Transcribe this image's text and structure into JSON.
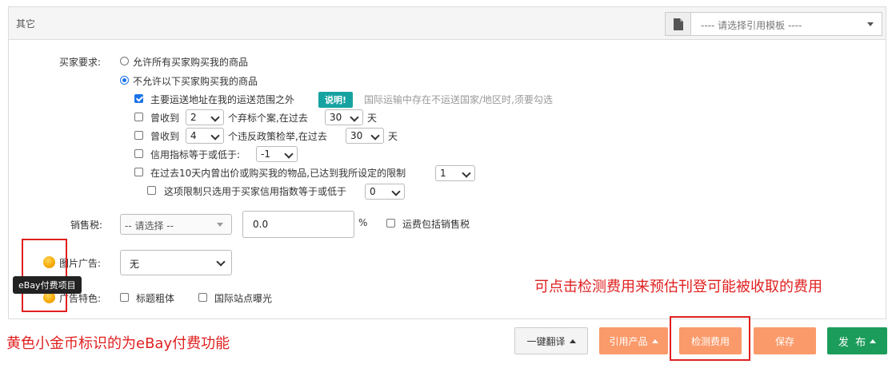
{
  "panel": {
    "title": "其它",
    "template_select": {
      "placeholder": "---- 请选择引用模板 ----",
      "icon": "document-icon"
    }
  },
  "buyer": {
    "label": "买家要求:",
    "option_all": "允许所有买家购买我的商品",
    "option_restrict": "不允许以下买家购买我的商品",
    "selected": "option_restrict",
    "rule1": {
      "text": "主要运送地址在我的运送范围之外",
      "checked": true,
      "badge": "说明!",
      "hint": "国际运输中存在不运送国家/地区时,须要勾选"
    },
    "rule2": {
      "prefix": "曾收到",
      "count": "2",
      "mid": "个弃标个案,在过去",
      "days": "30",
      "suffix": "天",
      "checked": false
    },
    "rule3": {
      "prefix": "曾收到",
      "count": "4",
      "mid": "个违反政策检举,在过去",
      "days": "30",
      "suffix": "天",
      "checked": false
    },
    "rule4": {
      "text": "信用指标等于或低于:",
      "value": "-1",
      "checked": false
    },
    "rule5": {
      "text": "在过去10天内曾出价或购买我的物品,已达到我所设定的限制",
      "value": "1",
      "checked": false
    },
    "rule6": {
      "text": "这项限制只选用于买家信用指数等于或低于",
      "value": "0",
      "checked": false
    }
  },
  "tax": {
    "label": "销售税:",
    "select_placeholder": "-- 请选择 --",
    "rate": "0.0",
    "percent": "%",
    "shipping_label": "运费包括销售税"
  },
  "gallery": {
    "label": "图片广告:",
    "value": "无"
  },
  "listing": {
    "label": "广告特色:",
    "bold_label": "标题粗体",
    "intl_label": "国际站点曝光"
  },
  "tooltip": "eBay付费项目",
  "annotations": {
    "fee_hint": "可点击检测费用来预估刊登可能被收取的费用",
    "coin_hint": "黄色小金币标识的为eBay付费功能"
  },
  "buttons": {
    "translate": "一键翻译",
    "cite_product": "引用产品",
    "check_fee": "检测费用",
    "save": "保存",
    "publish": "发  布"
  },
  "colors": {
    "accent_blue": "#1a73e8",
    "badge_teal": "#17a2a2",
    "orange_button": "#fa9a6a",
    "green_button": "#1c9c5a",
    "annotation_red": "#e02020",
    "coin_gold": "#f6a800"
  }
}
